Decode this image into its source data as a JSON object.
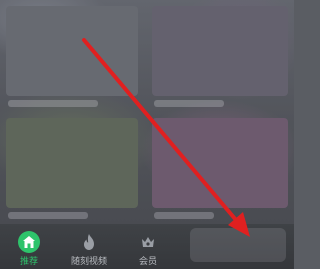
{
  "bottom_nav": {
    "tabs": [
      {
        "label": "推荐",
        "icon": "home-icon",
        "active": true
      },
      {
        "label": "随刻视频",
        "icon": "flame-icon",
        "active": false
      },
      {
        "label": "会员",
        "icon": "crown-icon",
        "active": false
      }
    ],
    "accent_color": "#2ec36b"
  },
  "annotation": {
    "type": "arrow",
    "color": "#e02020"
  }
}
